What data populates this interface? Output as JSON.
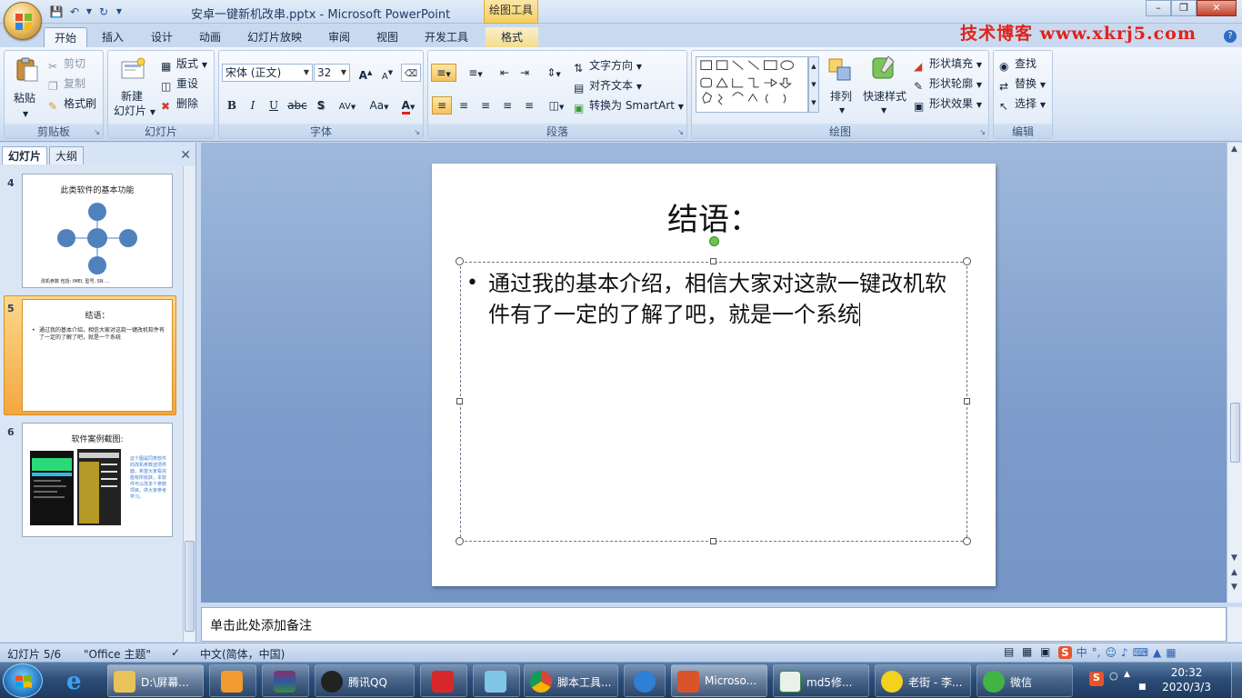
{
  "window": {
    "title": "安卓一键新机改串.pptx - Microsoft PowerPoint",
    "context_tab_group": "绘图工具",
    "watermark": "技术博客 www.xkrj5.com"
  },
  "ribbon_tabs": [
    "开始",
    "插入",
    "设计",
    "动画",
    "幻灯片放映",
    "审阅",
    "视图",
    "开发工具",
    "格式"
  ],
  "ribbon": {
    "clipboard": {
      "label": "剪贴板",
      "paste": "粘贴",
      "cut": "剪切",
      "copy": "复制",
      "format_painter": "格式刷"
    },
    "slides": {
      "label": "幻灯片",
      "new_slide_1": "新建",
      "new_slide_2": "幻灯片",
      "layout": "版式",
      "reset": "重设",
      "delete": "删除"
    },
    "font": {
      "label": "字体",
      "font_name": "宋体 (正文)",
      "font_size": "32",
      "bold": "B",
      "italic": "I",
      "underline": "U",
      "strike": "abc",
      "shadow": "S",
      "spacing": "AV",
      "case": "Aa",
      "color": "A",
      "grow": "A",
      "shrink": "A"
    },
    "paragraph": {
      "label": "段落",
      "text_direction": "文字方向",
      "align_text": "对齐文本",
      "smartart": "转换为 SmartArt"
    },
    "drawing": {
      "label": "绘图",
      "arrange": "排列",
      "quick_styles": "快速样式",
      "shape_fill": "形状填充",
      "shape_outline": "形状轮廓",
      "shape_effects": "形状效果"
    },
    "editing": {
      "label": "编辑",
      "find": "查找",
      "replace": "替换",
      "select": "选择"
    }
  },
  "left_panel": {
    "tabs": [
      "幻灯片",
      "大纲"
    ],
    "thumbnails": [
      {
        "num": "4",
        "title": "此类软件的基本功能",
        "nodes": [
          "功能选项",
          "功能选项",
          "功能选项",
          "基本功能",
          "功能选项"
        ],
        "footer": "改机参数 包括: IMEI, 型号, SN ..."
      },
      {
        "num": "5",
        "title": "结语：",
        "text": "通过我的基本介绍，相信大家对这款一键改机软件有了一定的了解了吧，就是一个系统"
      },
      {
        "num": "6",
        "title": "软件案例截图:",
        "text": "这个图是同类软件的改机参数选项界面，希望大家看完能有所收获，本软件可以改多个参数项目，供大家参考学习。"
      }
    ]
  },
  "slide": {
    "title": "结语：",
    "body": "通过我的基本介绍，相信大家对这款一键改机软件有了一定的了解了吧，就是一个系统"
  },
  "notes": {
    "placeholder": "单击此处添加备注"
  },
  "status": {
    "slide_info": "幻灯片 5/6",
    "theme": "\"Office 主题\"",
    "language": "中文(简体，中国)"
  },
  "ime": {
    "mode": "中",
    "punct": "°,"
  },
  "taskbar": {
    "items": [
      {
        "label": "D:\\屏幕...",
        "color": "#e8c25a"
      },
      {
        "label": "",
        "color": "#f29a2e"
      },
      {
        "label": "",
        "color": "#8b2d6a"
      },
      {
        "label": "腾讯QQ",
        "color": "#222"
      },
      {
        "label": "",
        "color": "#d8272b"
      },
      {
        "label": "",
        "color": "#7fc5e6"
      },
      {
        "label": "脚本工具...",
        "color": "#3a9c47"
      },
      {
        "label": "",
        "color": "#2f7fd4"
      },
      {
        "label": "Microso...",
        "color": "#d9532b"
      },
      {
        "label": "md5修...",
        "color": "#3a8a4a"
      },
      {
        "label": "老街 - 李...",
        "color": "#f2d21e"
      },
      {
        "label": "微信",
        "color": "#40b544"
      }
    ],
    "time": "20:32",
    "date": "2020/3/3"
  }
}
